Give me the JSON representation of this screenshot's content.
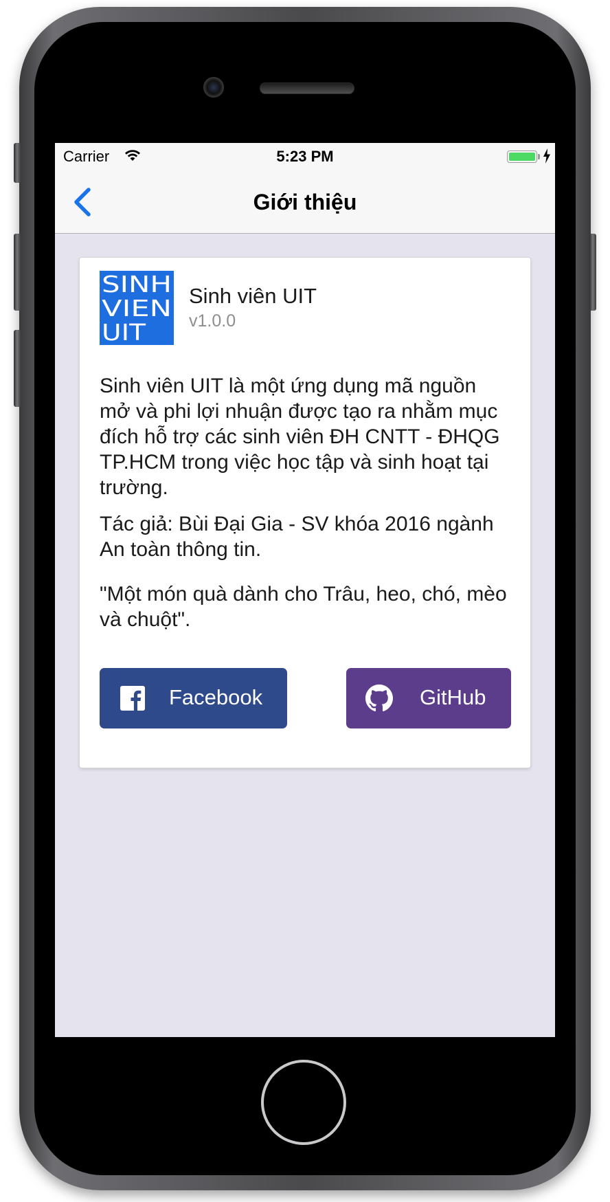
{
  "status_bar": {
    "carrier": "Carrier",
    "time": "5:23 PM"
  },
  "nav": {
    "title": "Giới thiệu",
    "back_icon": "chevron-left-icon",
    "accent_color": "#1a73e8"
  },
  "app": {
    "name": "Sinh viên UIT",
    "version": "v1.0.0",
    "logo_lines": [
      "SINH",
      "VIEN",
      "UIT"
    ],
    "logo_color": "#1e6ee0"
  },
  "content": {
    "description": "Sinh viên UIT là một ứng dụng mã nguồn mở và phi lợi nhuận được tạo ra nhằm mục đích hỗ trợ các sinh viên ĐH CNTT - ĐHQG TP.HCM trong việc học tập và sinh hoạt tại trường.",
    "author": "Tác giả: Bùi Đại Gia - SV khóa 2016 ngành An toàn thông tin.",
    "quote": "\"Một món quà dành cho Trâu, heo, chó, mèo và chuột\"."
  },
  "buttons": {
    "facebook": {
      "label": "Facebook",
      "icon": "facebook-icon",
      "color": "#2f4a8b"
    },
    "github": {
      "label": "GitHub",
      "icon": "github-icon",
      "color": "#5c3d8c"
    }
  }
}
